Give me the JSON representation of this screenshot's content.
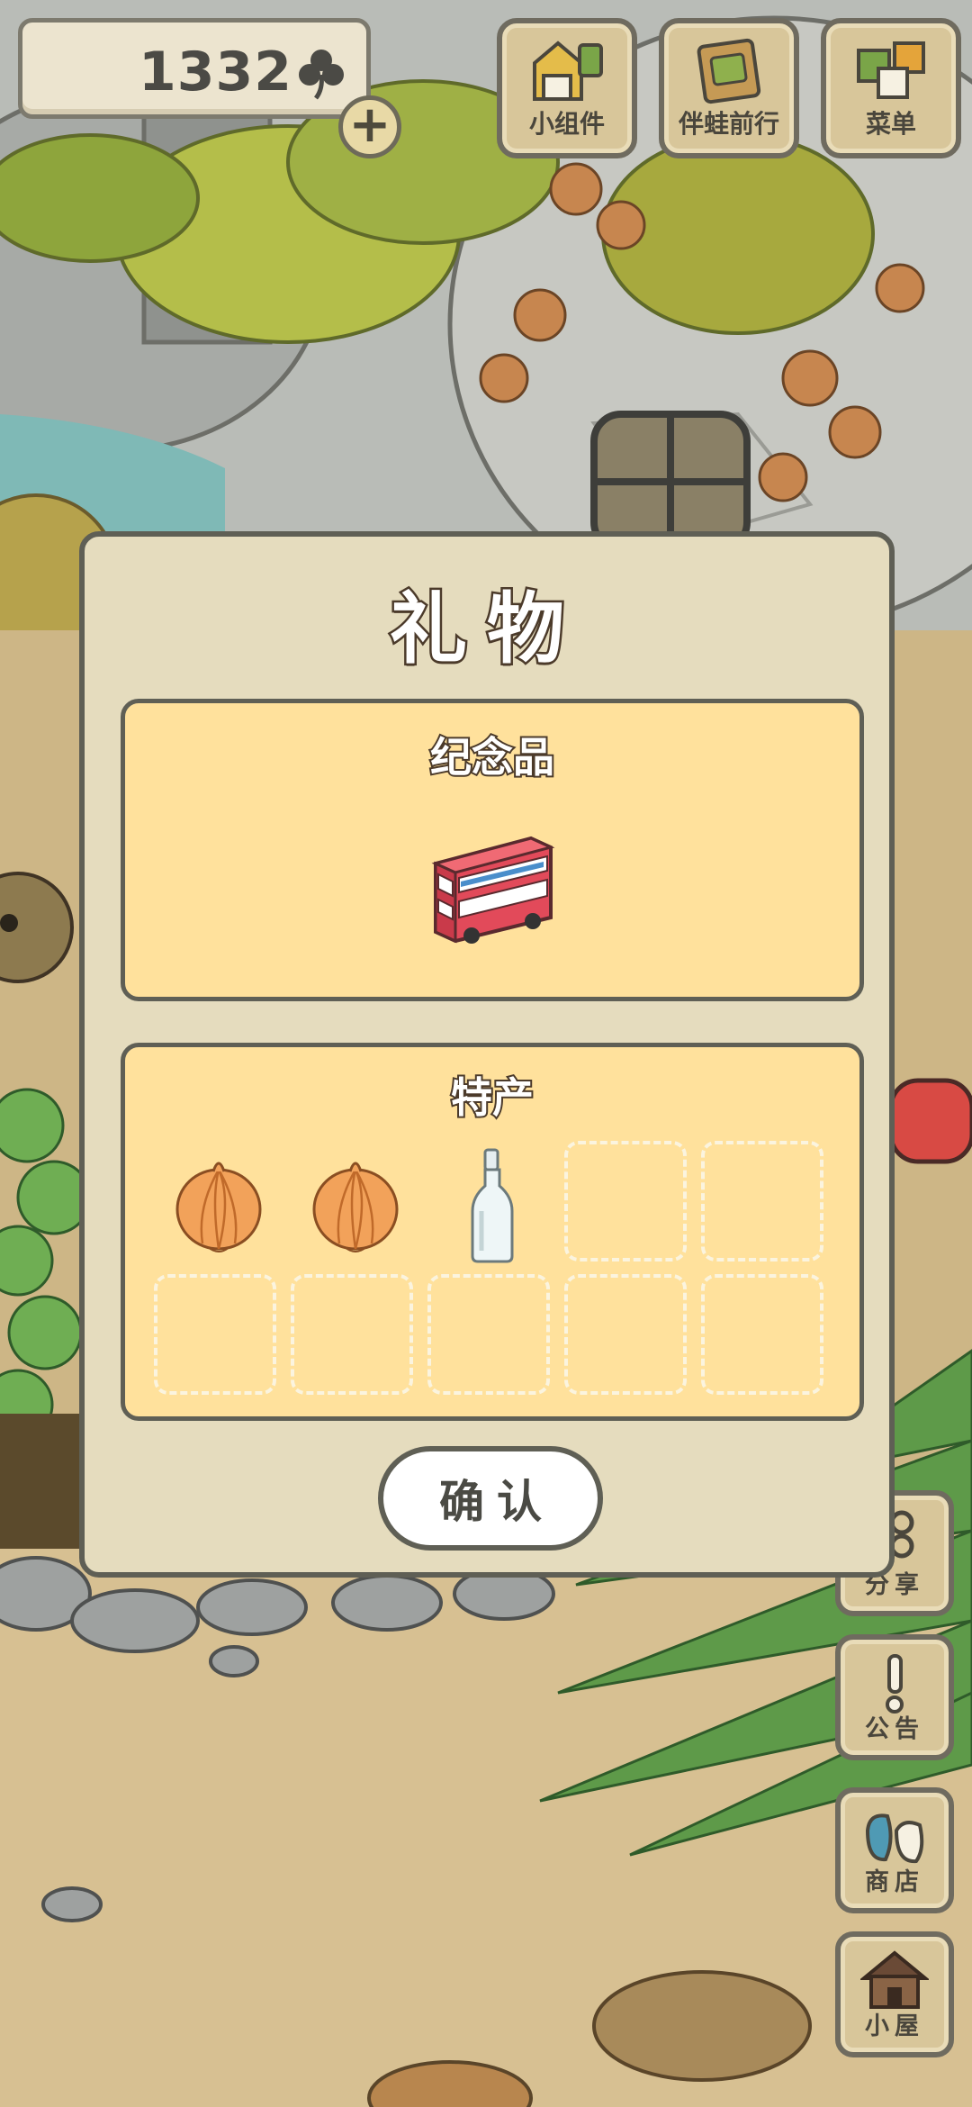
{
  "hud": {
    "clover_count": "1332",
    "buttons": [
      {
        "label": "小组件",
        "icon": "widget-icon"
      },
      {
        "label": "伴蛙前行",
        "icon": "travel-book-icon"
      },
      {
        "label": "菜单",
        "icon": "menu-cards-icon"
      }
    ]
  },
  "side_menu": [
    {
      "label": "分享",
      "icon": "share-icon"
    },
    {
      "label": "公告",
      "icon": "exclamation-icon"
    },
    {
      "label": "商店",
      "icon": "shop-bags-icon"
    },
    {
      "label": "小屋",
      "icon": "house-icon"
    }
  ],
  "gift_dialog": {
    "title": "礼物",
    "souvenir": {
      "title": "纪念品",
      "item": {
        "name": "bus-souvenir",
        "icon": "double-decker-bus-icon",
        "color": "#e24a5a"
      }
    },
    "specialty": {
      "title": "特产",
      "slots": [
        {
          "item": "onion"
        },
        {
          "item": "onion"
        },
        {
          "item": "glass-bottle"
        },
        {
          "item": null
        },
        {
          "item": null
        },
        {
          "item": null
        },
        {
          "item": null
        },
        {
          "item": null
        },
        {
          "item": null
        },
        {
          "item": null
        }
      ]
    },
    "confirm_label": "确认"
  },
  "colors": {
    "dialog_bg": "#e5dcbe",
    "panel_bg": "#ffe19c",
    "border": "#5f5f55",
    "title_outline": "#4b3a2a"
  }
}
